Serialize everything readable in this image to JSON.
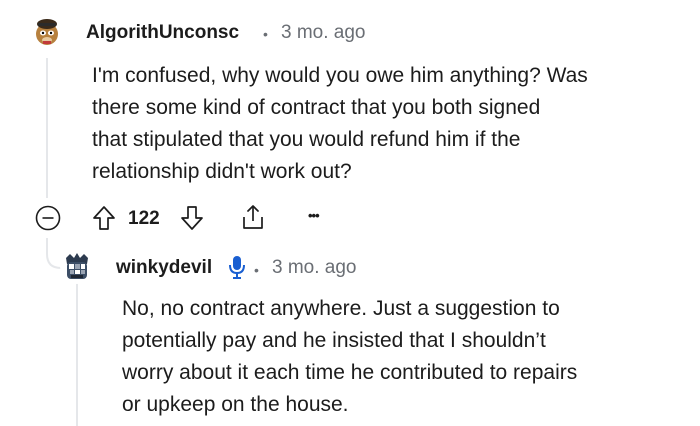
{
  "comment": {
    "username": "AlgorithUnconsc",
    "separator": "•",
    "time": "3 mo. ago",
    "body_lines": [
      "I'm confused, why would you owe him anything? Was",
      "there some kind of contract that you both signed",
      "that stipulated that you would refund him if the",
      "relationship didn't work out?"
    ],
    "actions": {
      "collapse_icon": "collapse-minus-icon",
      "upvote_icon": "upvote-arrow-icon",
      "vote_count": "122",
      "downvote_icon": "downvote-arrow-icon",
      "share_icon": "share-icon",
      "more_label": "•••"
    }
  },
  "reply": {
    "username": "winkydevil",
    "badge_icon": "microphone-icon",
    "separator": "•",
    "time": "3 mo. ago",
    "body_lines": [
      "No, no contract anywhere. Just a suggestion to",
      "potentially pay and he insisted that I shouldn’t",
      "worry about it each time he contributed to repairs",
      "or upkeep on the house."
    ]
  },
  "colors": {
    "thread_line": "#e5e7ea",
    "meta_text": "#6a6e74",
    "badge_blue": "#1a5fd1"
  }
}
